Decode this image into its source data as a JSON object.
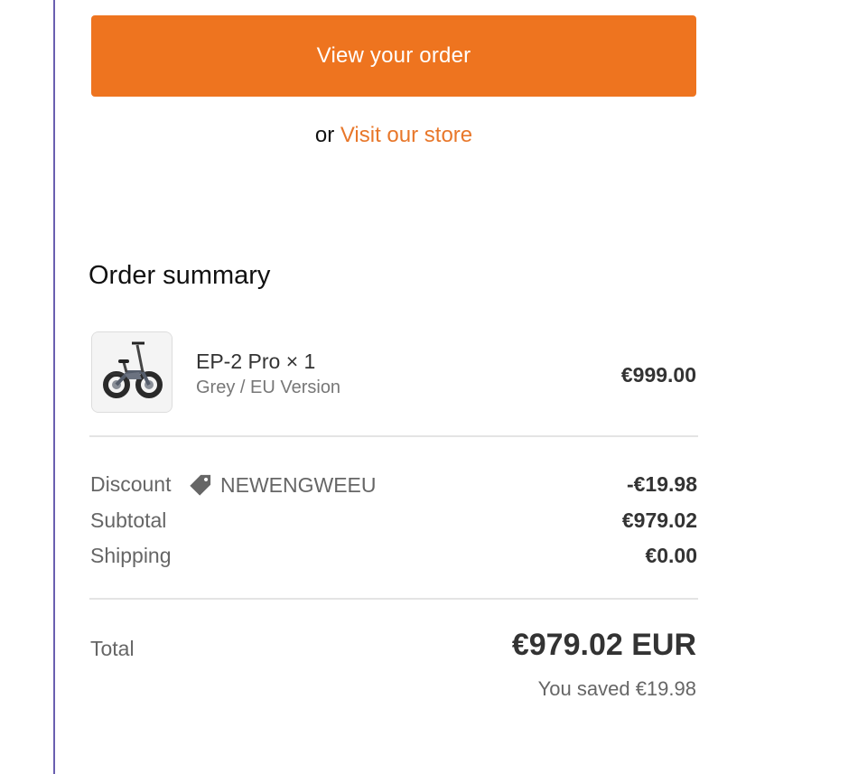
{
  "actions": {
    "view_order_label": "View your order",
    "or_text": "or",
    "visit_store_label": "Visit our store"
  },
  "summary": {
    "title": "Order summary",
    "product": {
      "name": "EP-2 Pro × 1",
      "variant": "Grey / EU Version",
      "price": "€999.00",
      "image_icon": "folding-ebike"
    },
    "discount": {
      "label": "Discount",
      "code": "NEWENGWEEU",
      "icon": "tag-icon",
      "value": "-€19.98"
    },
    "subtotal": {
      "label": "Subtotal",
      "value": "€979.02"
    },
    "shipping": {
      "label": "Shipping",
      "value": "€0.00"
    },
    "total": {
      "label": "Total",
      "value": "€979.02 EUR",
      "saved": "You saved €19.98"
    }
  },
  "colors": {
    "accent": "#ee741f",
    "link": "#e8772a",
    "left_rule": "#6a5fb0"
  }
}
